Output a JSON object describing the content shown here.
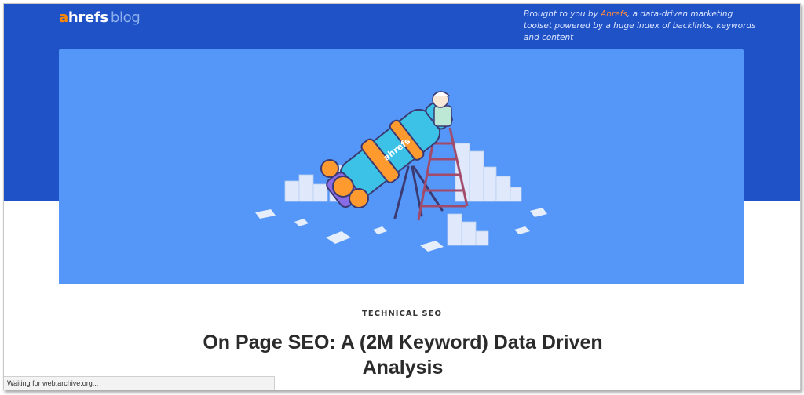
{
  "header": {
    "logo_a": "a",
    "logo_hrefs": "hrefs",
    "logo_blog": "blog",
    "tagline_prefix": "Brought to you by ",
    "tagline_brand": "Ahrefs",
    "tagline_suffix": ", a data-driven marketing toolset powered by a huge index of backlinks, keywords and content"
  },
  "hero": {
    "illustration": "telescope-illustration",
    "telescope_label": "ahrefs"
  },
  "article": {
    "category": "TECHNICAL SEO",
    "title": "On Page SEO: A (2M Keyword) Data Driven Analysis"
  },
  "status_bar": {
    "text": "Waiting for web.archive.org..."
  },
  "colors": {
    "header_blue": "#2052c7",
    "hero_blue": "#5597f8",
    "brand_orange": "#ff8800"
  }
}
